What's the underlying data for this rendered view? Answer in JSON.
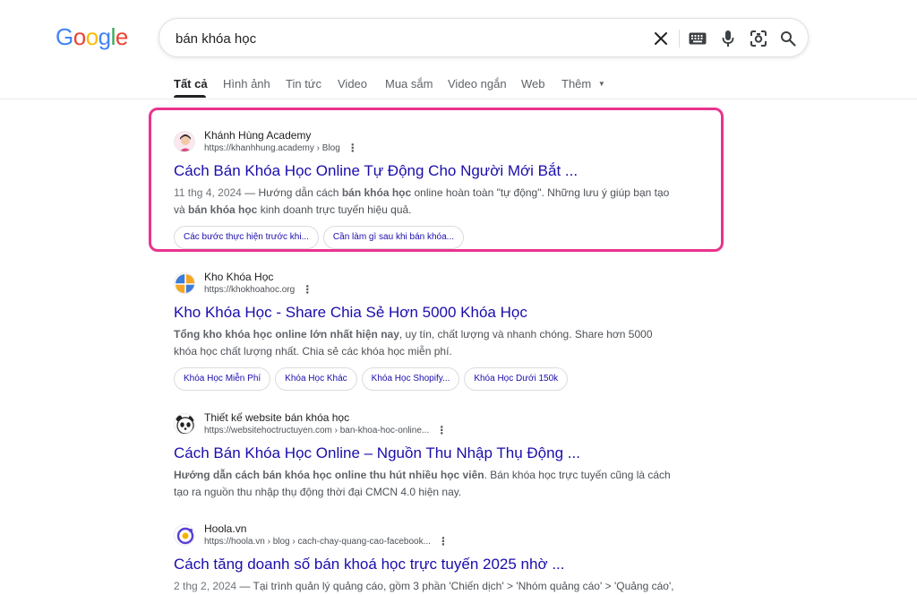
{
  "colors": {
    "google_blue": "#4285F4",
    "google_red": "#EA4335",
    "google_yellow": "#FBBC05",
    "google_green": "#34A853",
    "link": "#1a0dab",
    "highlight": "#e9338f"
  },
  "logo": {
    "letters": [
      "G",
      "o",
      "o",
      "g",
      "l",
      "e"
    ]
  },
  "search": {
    "query": "bán khóa học",
    "icons": [
      "close-icon",
      "keyboard-icon",
      "microphone-icon",
      "lens-icon",
      "search-icon"
    ]
  },
  "tabs": [
    {
      "label": "Tất cả",
      "active": true
    },
    {
      "label": "Hình ảnh"
    },
    {
      "label": "Tin tức"
    },
    {
      "label": "Video"
    },
    {
      "label": "Mua sắm"
    },
    {
      "label": "Video ngắn"
    },
    {
      "label": "Web"
    },
    {
      "label": "Thêm"
    }
  ],
  "results": [
    {
      "site_name": "Khánh Hùng Academy",
      "url": "https://khanhhung.academy › Blog",
      "title": "Cách Bán Khóa Học Online Tự Động Cho Người Mới Bắt ...",
      "date": "11 thg 4, 2024",
      "snippet_parts": [
        " — Hướng dẫn cách ",
        "bán khóa học",
        " online hoàn toàn \"tự động\". Những lưu ý giúp bạn tạo và ",
        "bán khóa học",
        " kinh doanh trực tuyến hiệu quả."
      ],
      "chips": [
        "Các bước thực hiện trước khi...",
        "Cần làm gì sau khi bán khóa..."
      ]
    },
    {
      "site_name": "Kho Khóa Học",
      "url": "https://khokhoahoc.org",
      "title": "Kho Khóa Học - Share Chia Sẻ Hơn 5000 Khóa Học",
      "snippet_parts": [
        "Tổng kho khóa học online lớn nhất hiện nay",
        ", uy tín, chất lượng và nhanh chóng. Share hơn 5000 khóa học chất lượng nhất. Chia sẻ các khóa học miễn phí."
      ],
      "chips": [
        "Khóa Học Miễn Phí",
        "Khóa Học Khác",
        "Khóa Học Shopify...",
        "Khóa Học Dưới 150k"
      ]
    },
    {
      "site_name": "Thiết kế website bán khóa học",
      "url": "https://websitehoctructuyen.com › ban-khoa-hoc-online...",
      "title": "Cách Bán Khóa Học Online – Nguồn Thu Nhập Thụ Động ...",
      "snippet_parts": [
        "Hướng dẫn cách bán khóa học online thu hút nhiều học viên",
        ". Bán khóa học trực tuyến cũng là cách tạo ra nguồn thu nhập thụ động thời đại CMCN 4.0 hiện nay."
      ]
    },
    {
      "site_name": "Hoola.vn",
      "url": "https://hoola.vn › blog › cach-chay-quang-cao-facebook...",
      "title": "Cách tăng doanh số bán khoá học trực tuyến 2025 nhờ ...",
      "date": "2 thg 2, 2024",
      "snippet_parts": [
        " — Tại trình quản lý quảng cáo, gồm 3 phần 'Chiến dịch' > 'Nhóm quảng cáo' > 'Quảng cáo',"
      ]
    }
  ]
}
